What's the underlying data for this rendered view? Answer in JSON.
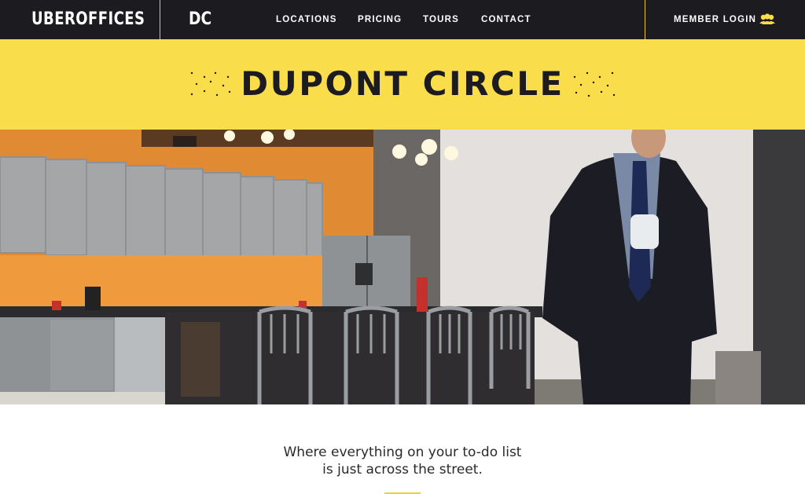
{
  "nav": {
    "brand": "UBEROFFICES",
    "city": "DC",
    "items": [
      {
        "label": "LOCATIONS"
      },
      {
        "label": "PRICING"
      },
      {
        "label": "TOURS"
      },
      {
        "label": "CONTACT"
      }
    ],
    "login_label": "MEMBER LOGIN",
    "login_icon": "members-icon"
  },
  "banner": {
    "title": "DUPONT CIRCLE",
    "background": "#fadd4a"
  },
  "hero": {
    "description_icon": "office-kitchen-photo"
  },
  "tagline": {
    "line1": "Where everything on your to-do list",
    "line2": "is just across the street."
  },
  "colors": {
    "nav_bg": "#1c1b20",
    "accent": "#fadd4a",
    "divider": "#e8c93e"
  }
}
